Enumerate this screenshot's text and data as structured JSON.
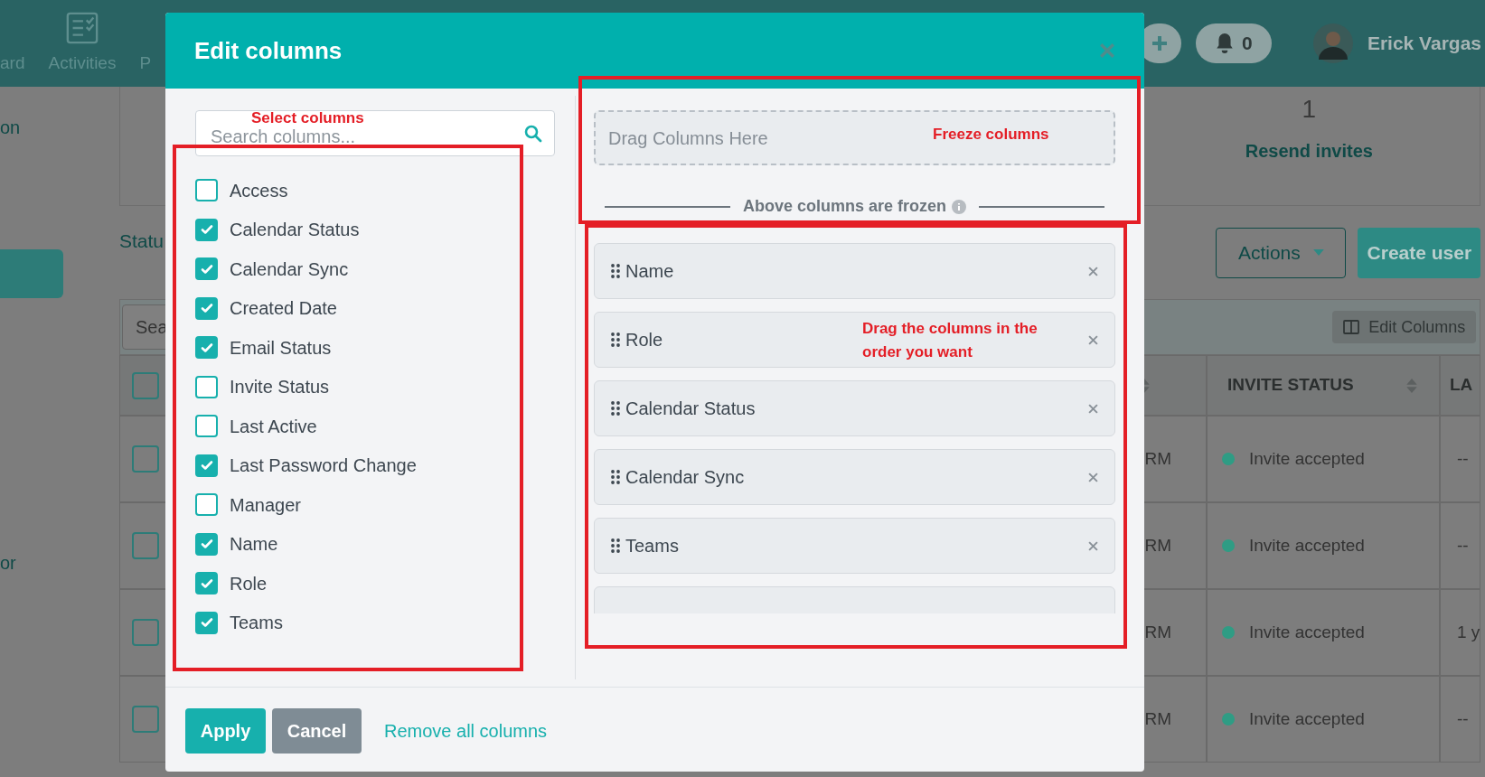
{
  "app_header": {
    "nav_items": [
      {
        "label": "ard",
        "kind": "text"
      },
      {
        "label": "Activities",
        "kind": "icon"
      },
      {
        "label": "P",
        "kind": "text"
      }
    ],
    "notification_count": "0",
    "user_name": "Erick Vargas"
  },
  "sidebar": {
    "top_label": "on",
    "bottom_label": "or"
  },
  "summary_card": {
    "value": "1",
    "link": "Resend invites"
  },
  "section_label": "Statu",
  "actions_button": "Actions",
  "create_button": "Create user",
  "table": {
    "search_placeholder": "Sea",
    "header_checked": false,
    "edit_columns_button": "Edit Columns",
    "columns": [
      "INVITE STATUS",
      "LA"
    ],
    "rows": [
      {
        "checked": false,
        "column_2": "RM",
        "invite_status": "Invite accepted",
        "column_4": "--"
      },
      {
        "checked": false,
        "column_2": "RM",
        "invite_status": "Invite accepted",
        "column_4": "--"
      },
      {
        "checked": false,
        "column_2": "RM",
        "invite_status": "Invite accepted",
        "column_4": "1 y"
      },
      {
        "checked": false,
        "column_2": "RM",
        "invite_status": "Invite accepted",
        "column_4": "--"
      }
    ]
  },
  "modal": {
    "title": "Edit columns",
    "search_placeholder": "Search columns...",
    "columns": [
      {
        "label": "Access",
        "checked": false
      },
      {
        "label": "Calendar Status",
        "checked": true
      },
      {
        "label": "Calendar Sync",
        "checked": true
      },
      {
        "label": "Created Date",
        "checked": true
      },
      {
        "label": "Email Status",
        "checked": true
      },
      {
        "label": "Invite Status",
        "checked": false
      },
      {
        "label": "Last Active",
        "checked": false
      },
      {
        "label": "Last Password Change",
        "checked": true
      },
      {
        "label": "Manager",
        "checked": false
      },
      {
        "label": "Name",
        "checked": true
      },
      {
        "label": "Role",
        "checked": true
      },
      {
        "label": "Teams",
        "checked": true
      }
    ],
    "drop_zone": "Drag Columns Here",
    "frozen_note": "Above columns are frozen",
    "ordered_columns": [
      "Name",
      "Role",
      "Calendar Status",
      "Calendar Sync",
      "Teams"
    ],
    "apply_button": "Apply",
    "cancel_button": "Cancel",
    "remove_link": "Remove all columns"
  },
  "annotations": {
    "select": "Select columns",
    "freeze": "Freeze columns",
    "drag": "Drag the columns in the order you want"
  }
}
